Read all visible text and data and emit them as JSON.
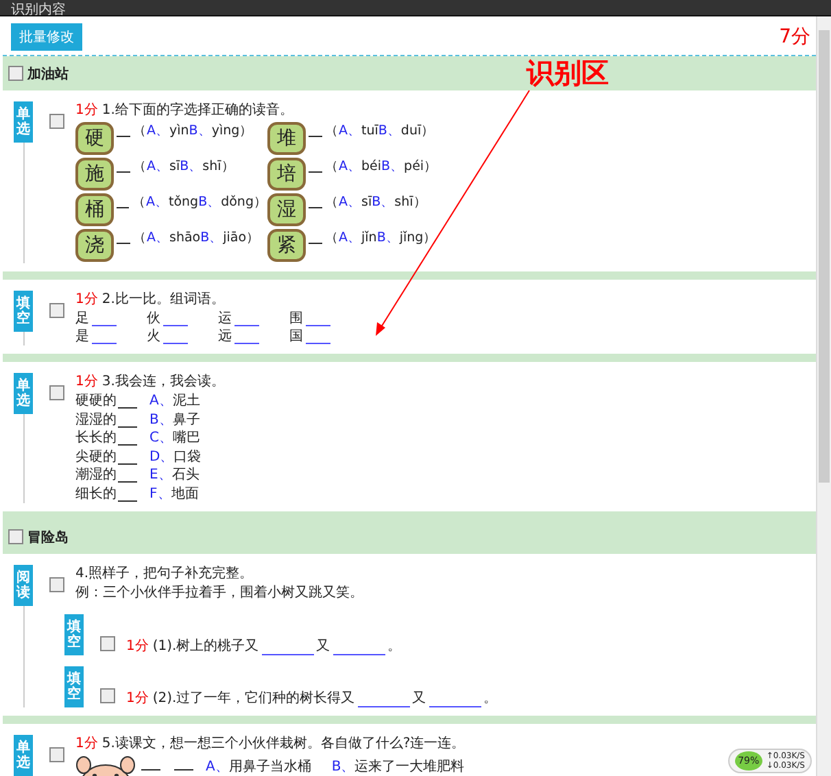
{
  "panel_title": "识别内容",
  "batch_button": "批量修改",
  "total_score": "7分",
  "annotation": "识别区",
  "sections": [
    {
      "title": "加油站",
      "checked": false,
      "questions": [
        {
          "kind": "pinyin",
          "tag": "单选",
          "checked": false,
          "score": "1分",
          "text": "1.给下面的字选择正确的读音。",
          "items": [
            {
              "char": "硬",
              "open": "（",
              "options": [
                {
                  "letter": "A、",
                  "text": "yìn"
                },
                {
                  "letter": "B、",
                  "text": "yìng"
                }
              ],
              "close": "）"
            },
            {
              "char": "堆",
              "open": "（",
              "options": [
                {
                  "letter": "A、",
                  "text": "tuī"
                },
                {
                  "letter": "B、",
                  "text": "duī"
                }
              ],
              "close": "）"
            },
            {
              "char": "施",
              "open": "（",
              "options": [
                {
                  "letter": "A、",
                  "text": "sī"
                },
                {
                  "letter": "B、",
                  "text": "shī"
                }
              ],
              "close": "）"
            },
            {
              "char": "培",
              "open": "（",
              "options": [
                {
                  "letter": "A、",
                  "text": "béi"
                },
                {
                  "letter": "B、",
                  "text": "péi"
                }
              ],
              "close": "）"
            },
            {
              "char": "桶",
              "open": "（",
              "options": [
                {
                  "letter": "A、",
                  "text": "tǒng"
                },
                {
                  "letter": "B、",
                  "text": "dǒng"
                }
              ],
              "close": "）"
            },
            {
              "char": "湿",
              "open": "（",
              "options": [
                {
                  "letter": "A、",
                  "text": "sī"
                },
                {
                  "letter": "B、",
                  "text": "shī"
                }
              ],
              "close": "）"
            },
            {
              "char": "浇",
              "open": "（",
              "options": [
                {
                  "letter": "A、",
                  "text": "shāo"
                },
                {
                  "letter": "B、",
                  "text": "jiāo"
                }
              ],
              "close": "）"
            },
            {
              "char": "紧",
              "open": "（",
              "options": [
                {
                  "letter": "A、",
                  "text": "jǐn"
                },
                {
                  "letter": "B、",
                  "text": "jǐng"
                }
              ],
              "close": "）"
            }
          ]
        },
        {
          "kind": "words",
          "tag": "填空",
          "checked": false,
          "score": "1分",
          "text": "2.比一比。组词语。",
          "rows": [
            [
              "足",
              "伙",
              "运",
              "围"
            ],
            [
              "是",
              "火",
              "远",
              "国"
            ]
          ]
        },
        {
          "kind": "match",
          "tag": "单选",
          "checked": false,
          "score": "1分",
          "text": "3.我会连，我会读。",
          "items": [
            {
              "left": "硬硬的",
              "letter": "A、",
              "right": "泥土"
            },
            {
              "left": "湿湿的",
              "letter": "B、",
              "right": "鼻子"
            },
            {
              "left": "长长的",
              "letter": "C、",
              "right": "嘴巴"
            },
            {
              "left": "尖硬的",
              "letter": "D、",
              "right": "口袋"
            },
            {
              "left": "潮湿的",
              "letter": "E、",
              "right": "石头"
            },
            {
              "left": "细长的",
              "letter": "F、",
              "right": "地面"
            }
          ]
        }
      ]
    },
    {
      "title": "冒险岛",
      "checked": false,
      "questions": [
        {
          "kind": "reading",
          "tag": "阅读",
          "checked": false,
          "text": "4.照样子，把句子补充完整。",
          "example": "例：三个小伙伴手拉着手，围着小树又跳又笑。",
          "subs": [
            {
              "tag": "填空",
              "checked": false,
              "score": "1分",
              "parts": [
                "(1).树上的桃子又",
                "又",
                "。"
              ]
            },
            {
              "tag": "填空",
              "checked": false,
              "score": "1分",
              "parts": [
                "(2).过了一年，它们种的树长得又",
                "又",
                "。"
              ]
            }
          ]
        },
        {
          "kind": "picture",
          "tag": "单选",
          "checked": false,
          "score": "1分",
          "text": "5.读课文，想一想三个小伙伴栽树。各自做了什么?连一连。",
          "options": [
            {
              "letter": "A、",
              "text": "用鼻子当水桶"
            },
            {
              "letter": "B、",
              "text": "运来了一大堆肥料"
            }
          ]
        }
      ]
    }
  ],
  "net_widget": {
    "percent": "79%",
    "up": "↑0.03K/S",
    "down": "↓0.03K/S"
  }
}
